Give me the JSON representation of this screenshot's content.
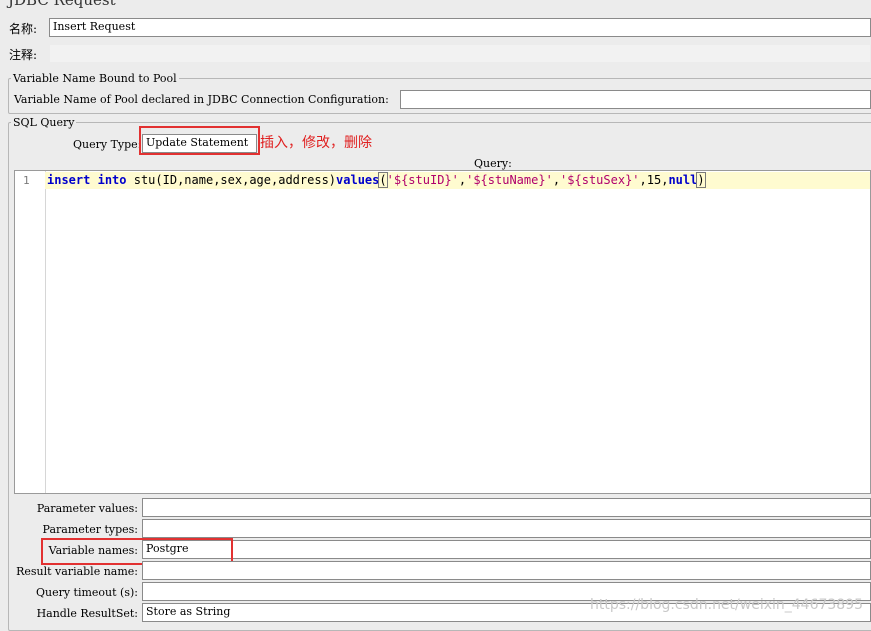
{
  "window": {
    "title": "JDBC Request"
  },
  "name_row": {
    "label": "名称:",
    "value": "Insert Request"
  },
  "comment_row": {
    "label": "注释:",
    "value": ""
  },
  "pool_section": {
    "legend": "Variable Name Bound to Pool",
    "label": "Variable Name of Pool declared in JDBC Connection Configuration:",
    "value": ""
  },
  "sql_section": {
    "legend": "SQL Query",
    "query_type_label": "Query Type:",
    "query_type_value": "Update Statement",
    "annotation": "插入，修改，删除",
    "query_header": "Query:",
    "line_number": "1",
    "code": {
      "kw_insert": "insert",
      "kw_into": "into",
      "plain1": "stu(ID,name,sex,age,address)",
      "kw_values": "values",
      "open": "(",
      "str1": "'${stuID}'",
      "comma1": ",",
      "str2": "'${stuName}'",
      "comma2": ",",
      "str3": "'${stuSex}'",
      "comma3": ",15,",
      "kw_null": "null",
      "close": ")"
    }
  },
  "params": [
    {
      "key": "parameter_values",
      "label": "Parameter values:",
      "value": ""
    },
    {
      "key": "parameter_types",
      "label": "Parameter types:",
      "value": ""
    },
    {
      "key": "variable_names",
      "label": "Variable names:",
      "value": "Postgre"
    },
    {
      "key": "result_variable_name",
      "label": "Result variable name:",
      "value": ""
    },
    {
      "key": "query_timeout",
      "label": "Query timeout (s):",
      "value": ""
    },
    {
      "key": "handle_resultset",
      "label": "Handle ResultSet:",
      "value": "Store as String"
    }
  ],
  "watermark": "https://blog.csdn.net/weixin_44673895",
  "colors": {
    "highlight_box": "#e23131",
    "annotation": "#e02020",
    "keyword": "#0000cc",
    "string": "#b0006c",
    "current_line": "#fffbd0"
  }
}
